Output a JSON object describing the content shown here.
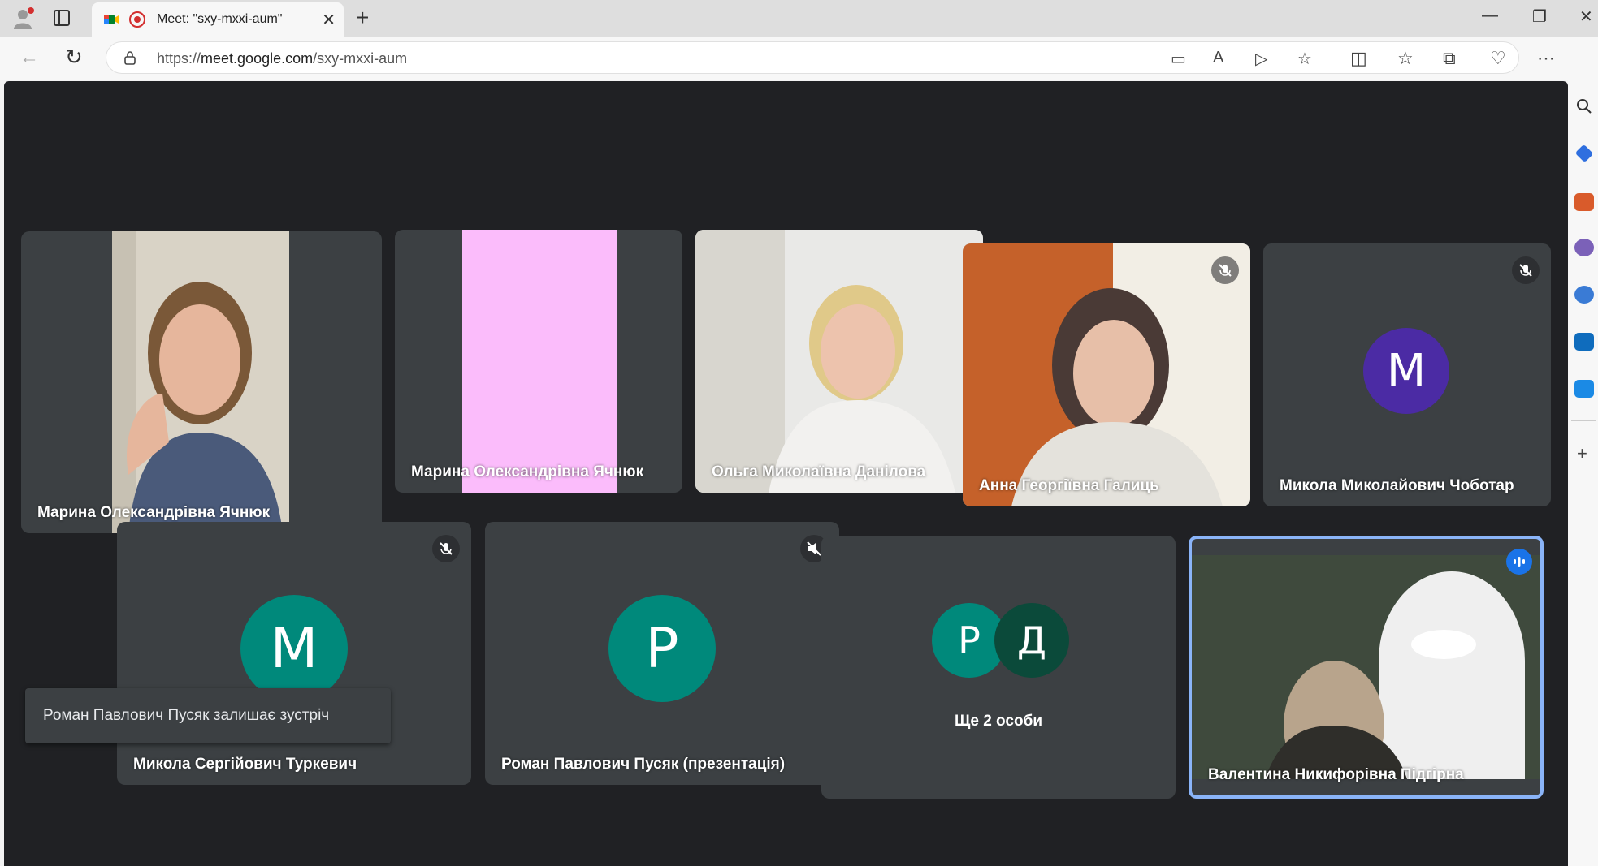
{
  "browser": {
    "tab_title": "Meet: \"sxy-mxxi-aum\"",
    "url_prefix": "https://",
    "url_domain": "meet.google.com",
    "url_path": "/sxy-mxxi-aum"
  },
  "tiles": [
    {
      "name": "Марина Олександрівна Ячнюк"
    },
    {
      "name": "Марина Олександрівна Ячнюк"
    },
    {
      "name": "Ольга Миколаївна Данілова"
    },
    {
      "name": "Анна Георгіївна Галиць"
    },
    {
      "name": "Микола Миколайович Чоботар",
      "initial": "М"
    },
    {
      "name": "Микола Сергійович Туркевич",
      "initial": "М"
    },
    {
      "name": "Роман Павлович Пусяк (презентація)",
      "initial": "Р"
    },
    {
      "name": "Ще 2 особи",
      "initials": [
        "Р",
        "Д"
      ]
    },
    {
      "name": "Валентина Никифорівна Підгірна"
    }
  ],
  "toast": "Роман Павлович Пусяк залишає зустріч",
  "colors": {
    "purple_avatar": "#4b2ba4",
    "teal_avatar": "#00897b",
    "dark_teal_avatar": "#0b4a3a",
    "speaking_border": "#8ab4f8"
  }
}
